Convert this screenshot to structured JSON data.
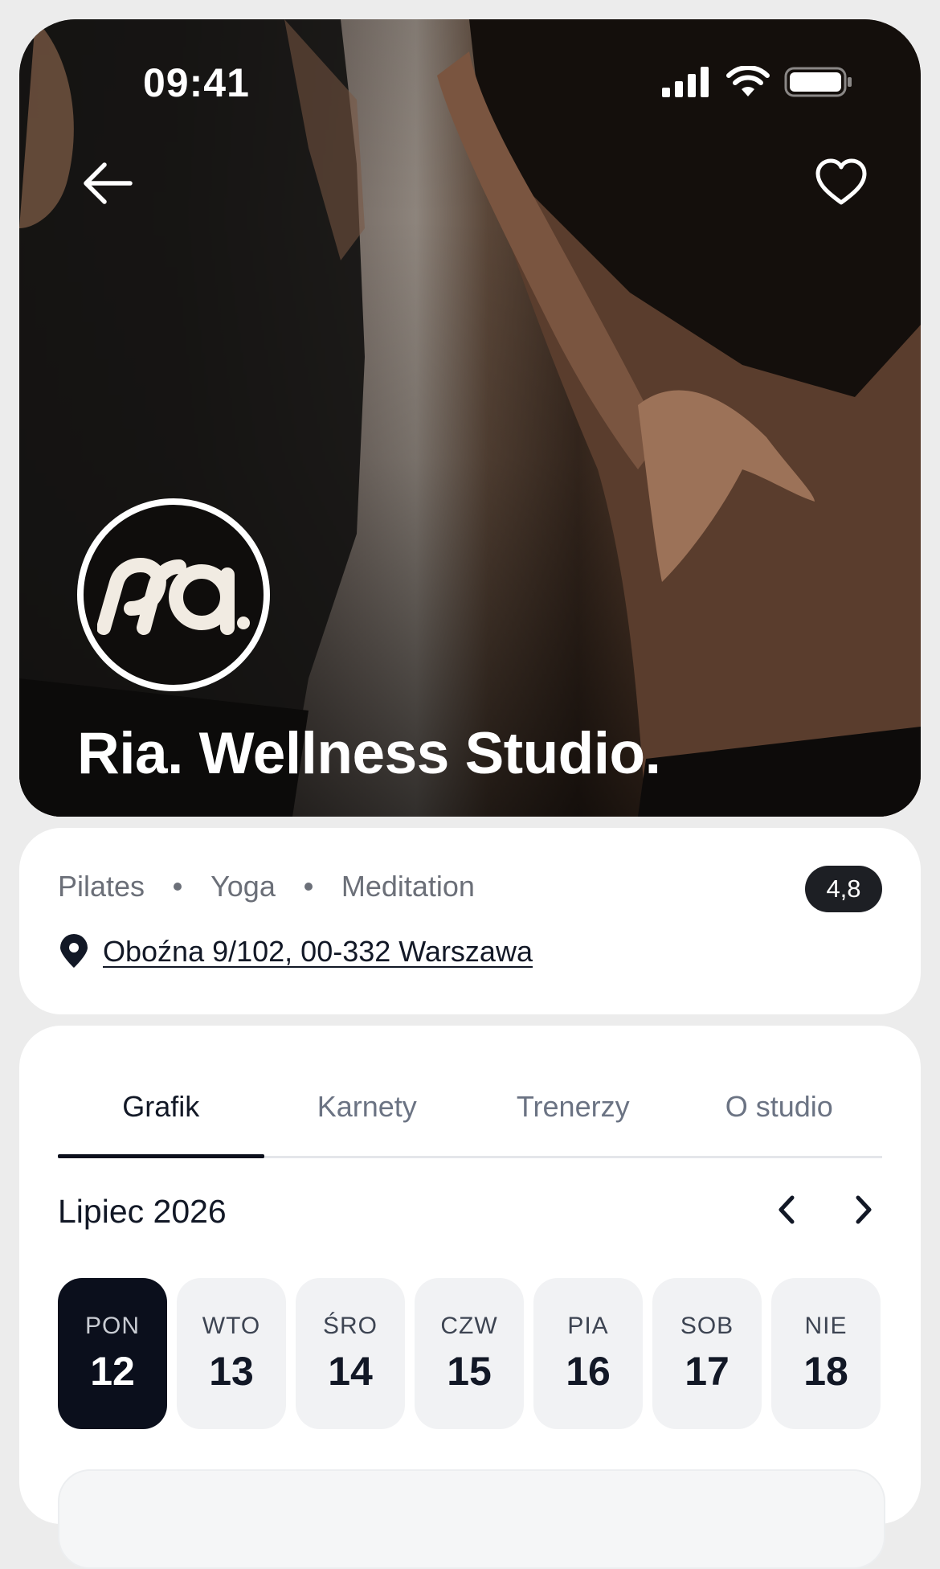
{
  "status_bar": {
    "time": "09:41"
  },
  "hero": {
    "title": "Ria. Wellness Studio.",
    "logo_text": "ria."
  },
  "info": {
    "tags": [
      "Pilates",
      "Yoga",
      "Meditation"
    ],
    "rating": "4,8",
    "address": "Oboźna 9/102, 00-332 Warszawa"
  },
  "tabs": [
    {
      "label": "Grafik",
      "active": true
    },
    {
      "label": "Karnety",
      "active": false
    },
    {
      "label": "Trenerzy",
      "active": false
    },
    {
      "label": "O studio",
      "active": false
    }
  ],
  "calendar": {
    "month_label": "Lipiec 2026",
    "days": [
      {
        "name": "PON",
        "num": "12",
        "selected": true
      },
      {
        "name": "WTO",
        "num": "13",
        "selected": false
      },
      {
        "name": "ŚRO",
        "num": "14",
        "selected": false
      },
      {
        "name": "CZW",
        "num": "15",
        "selected": false
      },
      {
        "name": "PIA",
        "num": "16",
        "selected": false
      },
      {
        "name": "SOB",
        "num": "17",
        "selected": false
      },
      {
        "name": "NIE",
        "num": "18",
        "selected": false
      }
    ]
  },
  "icons": {
    "back": "arrow-left-icon",
    "favorite": "heart-icon",
    "location": "map-pin-icon",
    "prev": "chevron-left-icon",
    "next": "chevron-right-icon"
  },
  "colors": {
    "accent_dark": "#0b0f1c",
    "muted_text": "#6b7383",
    "card_bg": "#ffffff",
    "page_bg": "#ececec"
  }
}
